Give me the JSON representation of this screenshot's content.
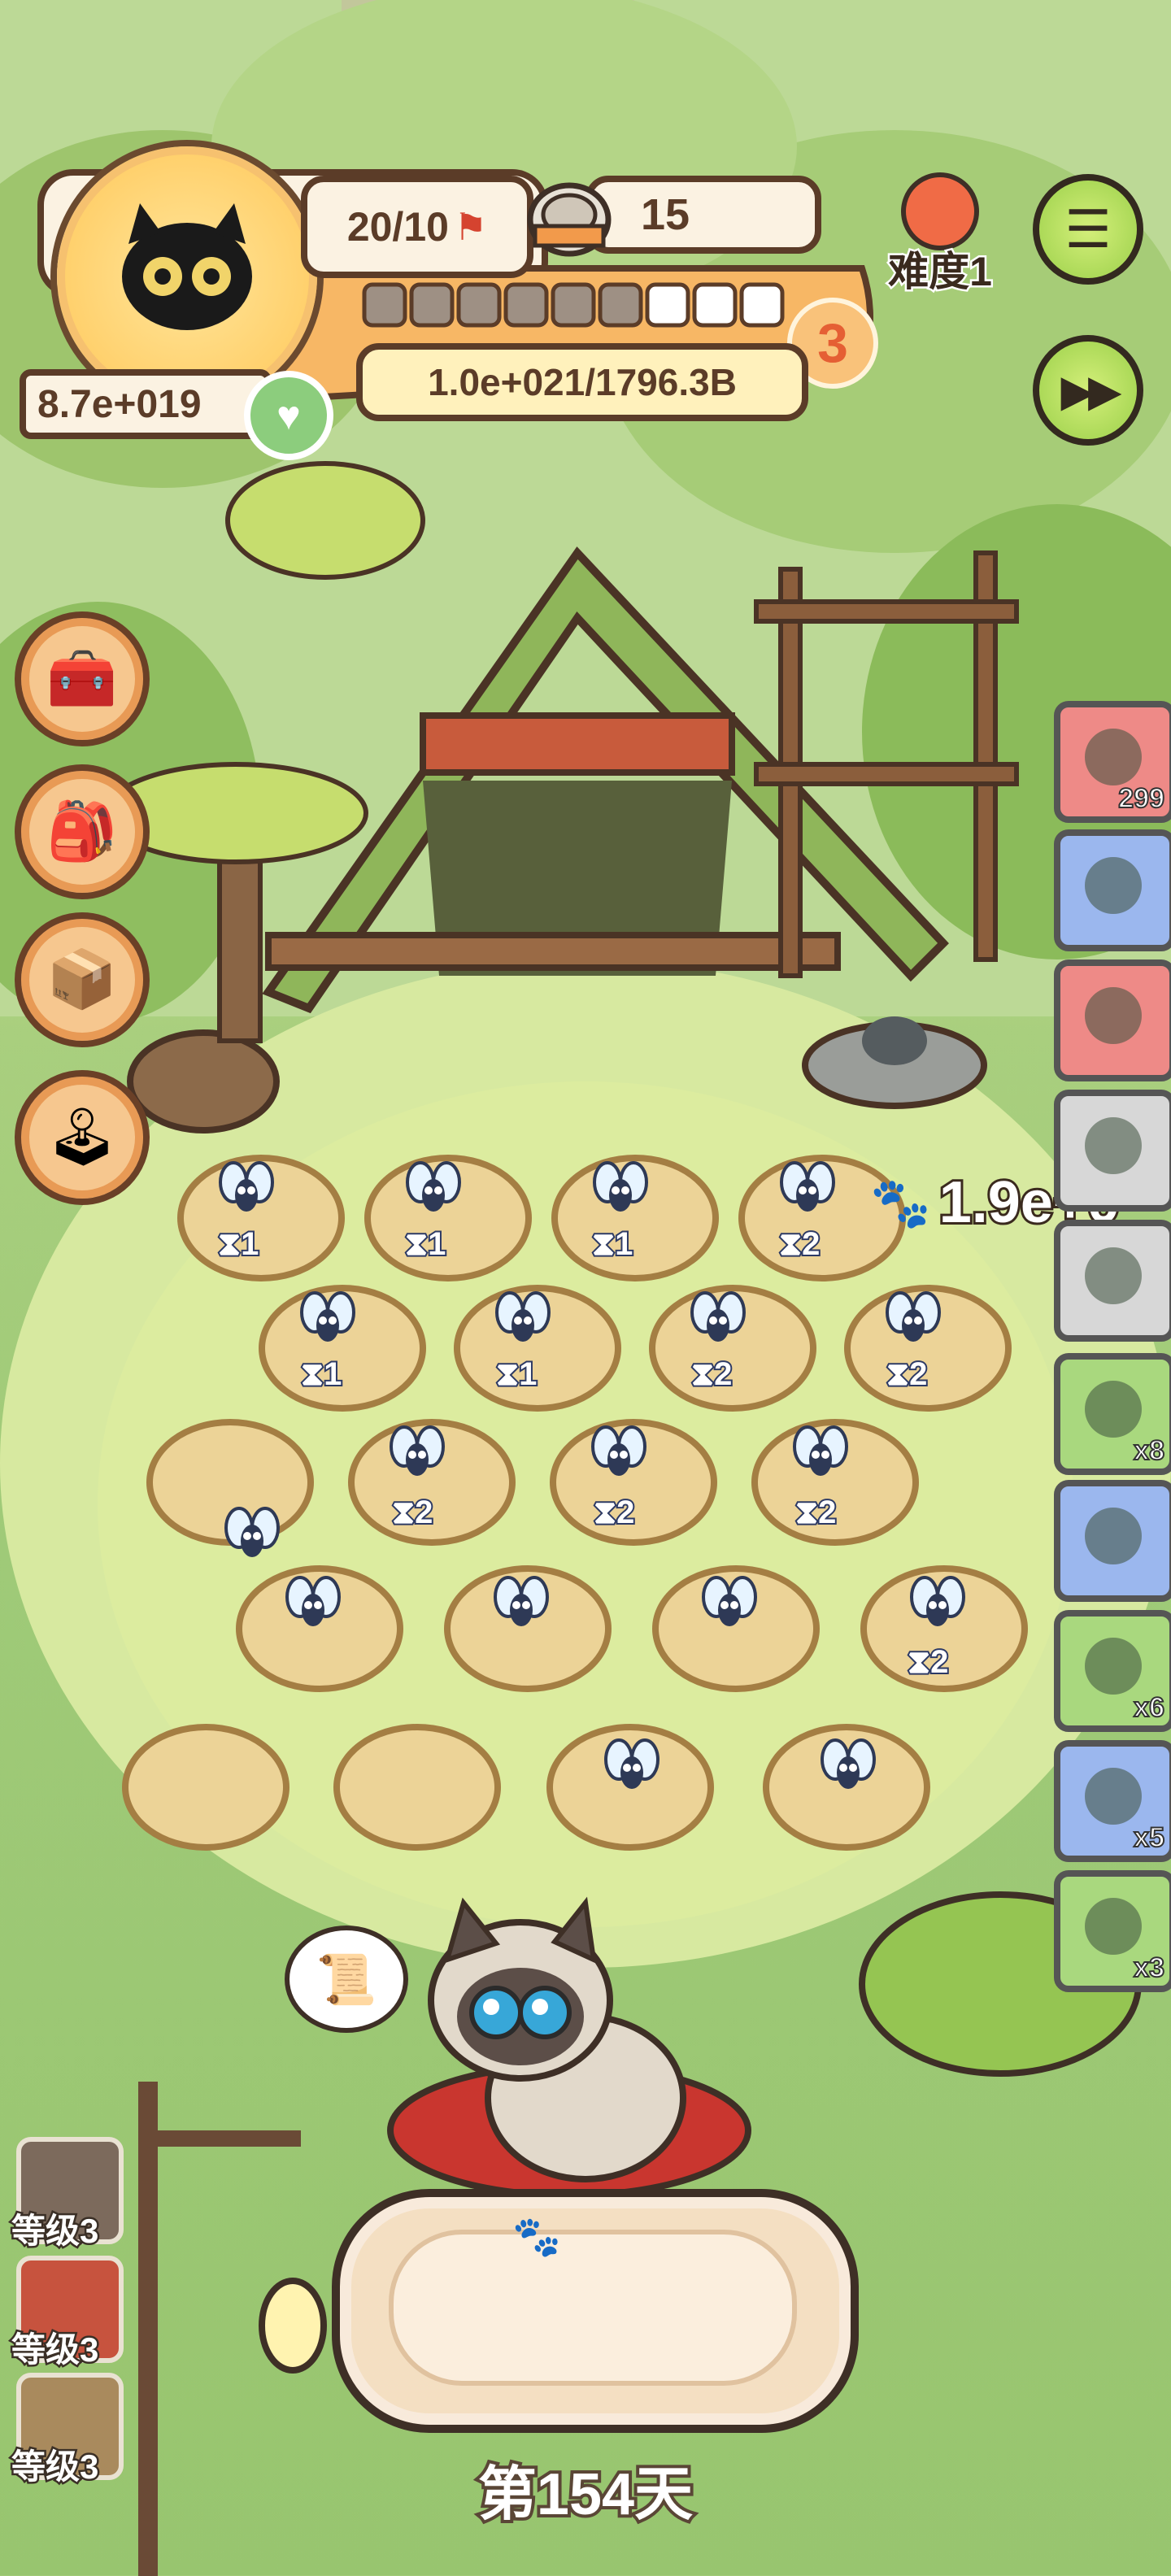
{
  "hud": {
    "capacity": "20/10",
    "food_count": "15",
    "difficulty": "难度1",
    "stage_number": "3",
    "progress": "1.0e+021/1796.3B",
    "coins": "8.7e+019",
    "progress_segments_filled": 6,
    "progress_segments_total": 9
  },
  "field": {
    "income_popup": "1.9e+0",
    "plots": [
      {
        "timer": "1"
      },
      {
        "timer": "1"
      },
      {
        "timer": "1"
      },
      {
        "timer": "2"
      },
      {
        "timer": "1"
      },
      {
        "timer": "1"
      },
      {
        "timer": "2"
      },
      {
        "timer": "2"
      },
      {
        "timer": ""
      },
      {
        "timer": "2"
      },
      {
        "timer": "2"
      },
      {
        "timer": "2"
      },
      {
        "timer": ""
      },
      {
        "timer": ""
      },
      {
        "timer": ""
      },
      {
        "timer": "2"
      },
      {
        "timer": ""
      },
      {
        "timer": ""
      },
      {
        "timer": ""
      },
      {
        "timer": ""
      }
    ]
  },
  "inventory": {
    "items": [
      {
        "name": "pebble-bag-icon",
        "count": "299",
        "color": "#ee8a87"
      },
      {
        "name": "feather-icon",
        "count": "",
        "color": "#9bb7ee"
      },
      {
        "name": "green-orb-icon",
        "count": "",
        "color": "#ee8a87"
      },
      {
        "name": "net-icon",
        "count": "",
        "color": "#d7d7d7"
      },
      {
        "name": "green-pods-icon",
        "count": "",
        "color": "#d7d7d7"
      },
      {
        "name": "lollipop-icon",
        "count": "x8",
        "color": "#a9d87e"
      },
      {
        "name": "snail-shell-icon",
        "count": "",
        "color": "#9bb7ee"
      },
      {
        "name": "potion-bottle-icon",
        "count": "x6",
        "color": "#a9d87e"
      },
      {
        "name": "mushroom-rock-icon",
        "count": "x5",
        "color": "#9bb7ee"
      },
      {
        "name": "tent-icon",
        "count": "x3",
        "color": "#a9d87e"
      }
    ]
  },
  "levels": [
    {
      "label": "等级3"
    },
    {
      "label": "等级3"
    },
    {
      "label": "等级3"
    }
  ],
  "day_label": "第154天"
}
